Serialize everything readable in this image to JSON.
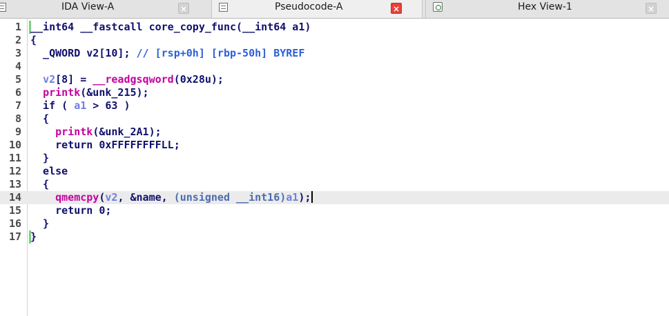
{
  "tabs": {
    "ida": {
      "label": "IDA View-A",
      "icon": "document-icon"
    },
    "pseudo": {
      "label": "Pseudocode-A",
      "icon": "document-icon",
      "active": true
    },
    "hex": {
      "label": "Hex View-1",
      "icon": "hex-icon"
    },
    "close_glyph": "×"
  },
  "colors": {
    "keyword": "#10106e",
    "comment": "#2d5fd6",
    "call": "#c4009e",
    "variable": "#6f7fe0",
    "highlight_line": "#ebebeb"
  },
  "code": {
    "current_line": 14,
    "lines": [
      {
        "n": "1",
        "parts": [
          [
            "t-plain",
            "__int64 __fastcall core_copy_func(__int64 a1)"
          ]
        ]
      },
      {
        "n": "2",
        "parts": [
          [
            "t-plain",
            "{"
          ]
        ]
      },
      {
        "n": "3",
        "parts": [
          [
            "t-plain",
            "  _QWORD v2[10]; "
          ],
          [
            "t-comment",
            "// [rsp+0h] [rbp-50h] BYREF"
          ]
        ]
      },
      {
        "n": "4",
        "parts": []
      },
      {
        "n": "5",
        "parts": [
          [
            "t-plain",
            "  "
          ],
          [
            "t-var",
            "v2"
          ],
          [
            "t-plain",
            "[8] = "
          ],
          [
            "t-call",
            "__readgsqword"
          ],
          [
            "t-plain",
            "(0x28u);"
          ]
        ]
      },
      {
        "n": "6",
        "parts": [
          [
            "t-plain",
            "  "
          ],
          [
            "t-call",
            "printk"
          ],
          [
            "t-plain",
            "(&unk_215);"
          ]
        ]
      },
      {
        "n": "7",
        "parts": [
          [
            "t-plain",
            "  if ( "
          ],
          [
            "t-var",
            "a1"
          ],
          [
            "t-plain",
            " > 63 )"
          ]
        ]
      },
      {
        "n": "8",
        "parts": [
          [
            "t-plain",
            "  {"
          ]
        ]
      },
      {
        "n": "9",
        "parts": [
          [
            "t-plain",
            "    "
          ],
          [
            "t-call",
            "printk"
          ],
          [
            "t-plain",
            "(&unk_2A1);"
          ]
        ]
      },
      {
        "n": "10",
        "parts": [
          [
            "t-plain",
            "    return 0xFFFFFFFFLL;"
          ]
        ]
      },
      {
        "n": "11",
        "parts": [
          [
            "t-plain",
            "  }"
          ]
        ]
      },
      {
        "n": "12",
        "parts": [
          [
            "t-plain",
            "  else"
          ]
        ]
      },
      {
        "n": "13",
        "parts": [
          [
            "t-plain",
            "  {"
          ]
        ]
      },
      {
        "n": "14",
        "parts": [
          [
            "t-plain",
            "    "
          ],
          [
            "t-call",
            "qmemcpy"
          ],
          [
            "t-plain",
            "("
          ],
          [
            "t-var",
            "v2"
          ],
          [
            "t-plain",
            ", &name, "
          ],
          [
            "t-muted",
            "(unsigned __int16)"
          ],
          [
            "t-var",
            "a1"
          ],
          [
            "t-plain",
            ");"
          ]
        ]
      },
      {
        "n": "15",
        "parts": [
          [
            "t-plain",
            "    return 0;"
          ]
        ]
      },
      {
        "n": "16",
        "parts": [
          [
            "t-plain",
            "  }"
          ]
        ]
      },
      {
        "n": "17",
        "parts": [
          [
            "t-plain",
            "}"
          ]
        ]
      }
    ]
  }
}
